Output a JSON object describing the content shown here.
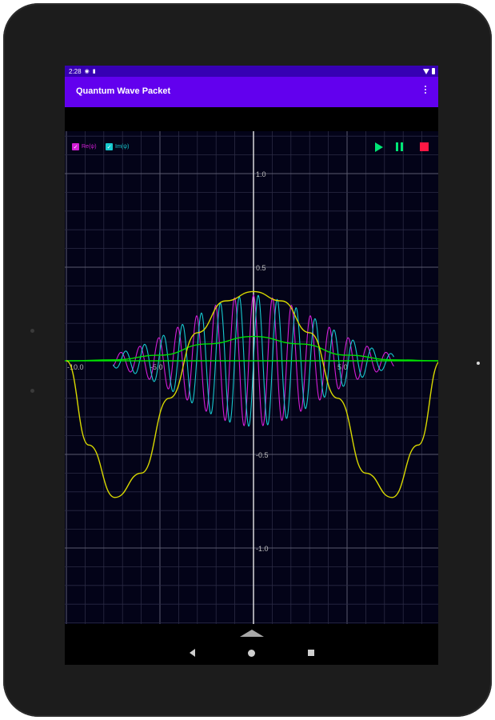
{
  "status_bar": {
    "time": "2:28"
  },
  "app_bar": {
    "title": "Quantum Wave Packet"
  },
  "legend": [
    {
      "label": "Re(ψ)",
      "color": "#d21ed6"
    },
    {
      "label": "Im(ψ)",
      "color": "#17c9cf"
    }
  ],
  "controls": [
    "play-icon",
    "pause-icon",
    "stop-icon"
  ],
  "colors": {
    "status_bar": "#3700b3",
    "app_bar": "#6200ee",
    "plot_bg": "#030318",
    "real_part": "#d21ed6",
    "imag_part": "#17c9cf",
    "probability": "#00e000",
    "potential": "#d8d800",
    "play": "#00e676",
    "stop": "#ff1744"
  },
  "chart_data": {
    "type": "line",
    "xlim": [
      -10,
      10
    ],
    "ylim": [
      -1.4,
      1.2
    ],
    "grid": true,
    "x_ticks": [
      {
        "value": -10,
        "label": "-10.0"
      },
      {
        "value": -5,
        "label": "-5.0"
      },
      {
        "value": 5,
        "label": "5.0"
      }
    ],
    "y_ticks": [
      {
        "value": 1.0,
        "label": "1.0"
      },
      {
        "value": 0.5,
        "label": "0.5"
      },
      {
        "value": -0.5,
        "label": "-0.5"
      },
      {
        "value": -1.0,
        "label": "-1.0"
      }
    ],
    "series": [
      {
        "name": "Re(ψ)",
        "key": "real",
        "color": "#d21ed6",
        "envelope_amplitude": 0.35,
        "envelope_width": 3.5,
        "extent": 7.5,
        "wavenumber": 6.2
      },
      {
        "name": "Im(ψ)",
        "key": "imag",
        "color": "#17c9cf",
        "envelope_amplitude": 0.35,
        "envelope_width": 3.5,
        "extent": 7.5,
        "wavenumber": 6.2
      },
      {
        "key": "probability",
        "color": "#00e000",
        "points": [
          [
            -10,
            0
          ],
          [
            -7.5,
            0.005
          ],
          [
            -5,
            0.03
          ],
          [
            -2.5,
            0.09
          ],
          [
            0,
            0.13
          ],
          [
            2.5,
            0.09
          ],
          [
            5,
            0.03
          ],
          [
            7.5,
            0.005
          ],
          [
            10,
            0
          ]
        ]
      },
      {
        "key": "potential",
        "color": "#d8d800",
        "points": [
          [
            -10,
            0
          ],
          [
            -8.8,
            -0.45
          ],
          [
            -7.4,
            -0.73
          ],
          [
            -6,
            -0.6
          ],
          [
            -4.5,
            -0.2
          ],
          [
            -3,
            0.15
          ],
          [
            -1.5,
            0.32
          ],
          [
            0,
            0.37
          ],
          [
            1.5,
            0.32
          ],
          [
            3,
            0.15
          ],
          [
            4.5,
            -0.2
          ],
          [
            6,
            -0.6
          ],
          [
            7.4,
            -0.73
          ],
          [
            8.8,
            -0.45
          ],
          [
            10,
            0
          ]
        ]
      }
    ]
  }
}
